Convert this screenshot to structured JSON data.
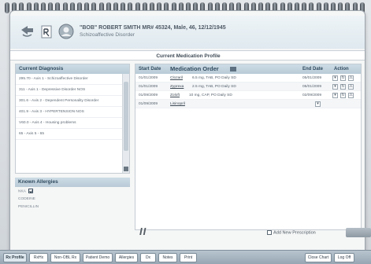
{
  "patient": {
    "summary": "\"BOB\" ROBERT SMITH MR# 45324, Male, 46, 12/12/1945",
    "diagnosis": "Schizoaffective Disorder"
  },
  "page_title": "Current Medication Profile",
  "diagnoses": {
    "heading": "Current Diagnosis",
    "items": [
      "295.70 - Axis 1 - Schizoaffective Disorder",
      "311 - Axis 1 - Depressive Disorder NOS",
      "301.6 - Axis 2 - Dependent Personality Disorder",
      "401.9 - Axis 3 - HYPERTENSION NOS",
      "V60.0 - Axis 4 - Housing problems",
      "65 - Axis 5 - 65"
    ]
  },
  "allergies": {
    "heading": "Known Allergies",
    "items": [
      "NKA",
      "CODEINE",
      "PENICILLIN"
    ]
  },
  "medications": {
    "headers": {
      "start": "Start Date",
      "order": "Medication Order",
      "end": "End Date",
      "action": "Action"
    },
    "rows": [
      {
        "start": "01/01/2009",
        "drug": "Clozaril",
        "sig": "6.5 mg, TAB, PO Daily SD",
        "end": "05/01/2009"
      },
      {
        "start": "01/01/2009",
        "drug": "Zyprexa",
        "sig": "2.5 mg, TAB, PO Daily SD",
        "end": "05/01/2009"
      },
      {
        "start": "01/09/2009",
        "drug": "Zoloft",
        "sig": "10 mg, CAP, PO Daily SD",
        "end": "02/09/2009"
      },
      {
        "start": "01/09/2009",
        "drug": "Lisinopril",
        "sig": "",
        "end": ""
      }
    ]
  },
  "cursor_text": "II",
  "add_rx_label": "Add New Prescription",
  "tabs": [
    "Rx Profile",
    "RxHx",
    "Non-OBL Rx",
    "Patient Demo",
    "Allergies",
    "Dx",
    "Notes",
    "Print",
    "Close Chart",
    "Log Off"
  ],
  "colors": {
    "header_gradient": "#cddce6",
    "panel_text": "#2f4a5e",
    "tabbar": "#96a6b2"
  },
  "icons": {
    "back_icon": "arrow-left",
    "rx_icon": "rx-document",
    "patient_icon": "person-portrait"
  }
}
